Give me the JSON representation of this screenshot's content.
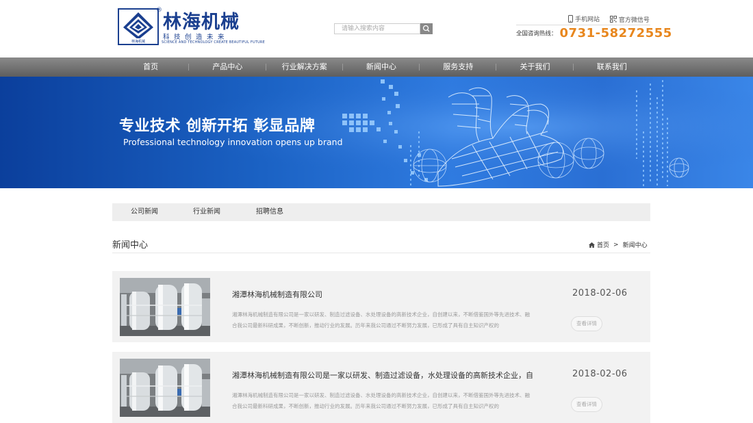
{
  "header": {
    "logo": {
      "name": "林海机械",
      "registered_mark": "®",
      "slogan": "科技创造未来",
      "slogan_en": "SCIENCE AND TECHNOLOGY CREATE BEAUTIFUL FUTURE",
      "badge_text": "林海机械"
    },
    "search": {
      "placeholder": "请输入搜索内容",
      "icon": "search-icon"
    },
    "links": [
      {
        "label": "手机网站",
        "icon": "mobile-icon"
      },
      {
        "label": "官方微信号",
        "icon": "qrcode-icon"
      }
    ],
    "hotline": {
      "label": "全国咨询热线：",
      "number": "0731-58272555"
    }
  },
  "nav": {
    "items": [
      {
        "label": "首页"
      },
      {
        "label": "产品中心"
      },
      {
        "label": "行业解决方案"
      },
      {
        "label": "新闻中心"
      },
      {
        "label": "服务支持"
      },
      {
        "label": "关于我们"
      },
      {
        "label": "联系我们"
      }
    ]
  },
  "banner": {
    "slogan_cn": "专业技术  创新开拓  彰显品牌",
    "slogan_en": "Professional technology innovation opens up brand"
  },
  "subnav": {
    "tabs": [
      {
        "label": "公司新闻"
      },
      {
        "label": "行业新闻"
      },
      {
        "label": "招聘信息"
      }
    ]
  },
  "section": {
    "title": "新闻中心",
    "breadcrumb": {
      "home": "首页",
      "separator": ">",
      "current": "新闻中心",
      "icon": "home-icon"
    }
  },
  "news": [
    {
      "title": "湘潭林海机械制造有限公司",
      "summary": "湘潭林海机械制造有限公司是一家以研发、制造过滤设备、水处理设备的高新技术企业，自创建以来，不断借鉴国外等先进技术、融合我公司最新科研成果，不断创新，推动行业的发展。历年来我公司通过不断努力发展，已形成了具有自主知识产权的",
      "date": "2018-02-06",
      "more": "查看详情"
    },
    {
      "title": "湘潭林海机械制造有限公司是一家以研发、制造过滤设备，水处理设备的高新技术企业，自创",
      "summary": "湘潭林海机械制造有限公司是一家以研发、制造过滤设备、水处理设备的高新技术企业，自创建以来，不断借鉴国外等先进技术、融合我公司最新科研成果，不断创新，推动行业的发展。历年来我公司通过不断努力发展，已形成了具有自主知识产权的",
      "date": "2018-02-06",
      "more": "查看详情"
    }
  ],
  "colors": {
    "brand": "#1a3f8f",
    "hotline": "#e8871e",
    "nav": "#6e6e6e",
    "banner": "#1b62c4"
  }
}
